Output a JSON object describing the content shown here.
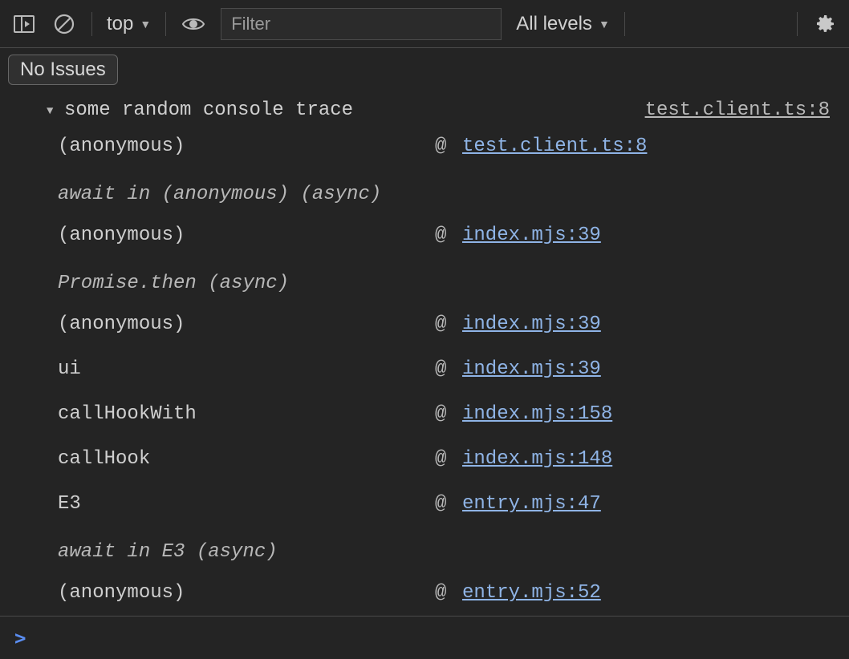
{
  "toolbar": {
    "context_label": "top",
    "filter_placeholder": "Filter",
    "levels_label": "All levels"
  },
  "issues": {
    "button_label": "No Issues"
  },
  "trace": {
    "message": "some random console trace",
    "source_link": "test.client.ts:8",
    "frames": [
      {
        "type": "frame",
        "fn": "(anonymous)",
        "loc": "test.client.ts:8"
      },
      {
        "type": "async",
        "label": "await in (anonymous) (async)"
      },
      {
        "type": "frame",
        "fn": "(anonymous)",
        "loc": "index.mjs:39"
      },
      {
        "type": "async",
        "label": "Promise.then (async)"
      },
      {
        "type": "frame",
        "fn": "(anonymous)",
        "loc": "index.mjs:39"
      },
      {
        "type": "frame",
        "fn": "ui",
        "loc": "index.mjs:39"
      },
      {
        "type": "frame",
        "fn": "callHookWith",
        "loc": "index.mjs:158"
      },
      {
        "type": "frame",
        "fn": "callHook",
        "loc": "index.mjs:148"
      },
      {
        "type": "frame",
        "fn": "E3",
        "loc": "entry.mjs:47"
      },
      {
        "type": "async",
        "label": "await in E3 (async)"
      },
      {
        "type": "frame",
        "fn": "(anonymous)",
        "loc": "entry.mjs:52"
      }
    ]
  },
  "symbols": {
    "at": "@"
  }
}
